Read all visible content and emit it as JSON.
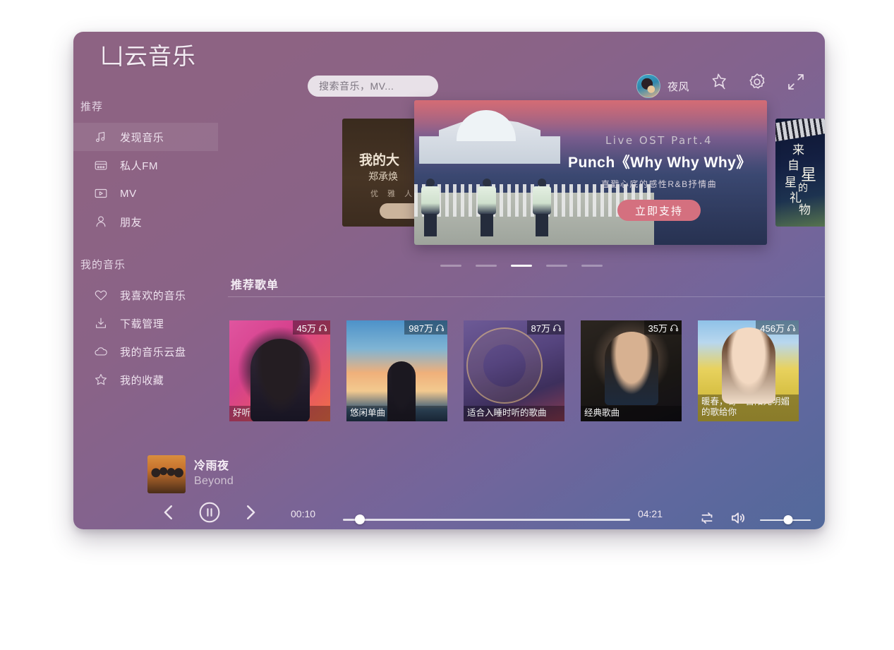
{
  "app": {
    "logo": "凵云音乐",
    "search_placeholder": "搜索音乐，MV...",
    "username": "夜风"
  },
  "header_icons": [
    {
      "name": "magic-star-icon",
      "label": "皮肤"
    },
    {
      "name": "gear-icon",
      "label": "设置"
    },
    {
      "name": "expand-icon",
      "label": "全屏"
    }
  ],
  "sidebar": {
    "section1_title": "推荐",
    "section1_items": [
      {
        "label": "发现音乐",
        "icon": "music-note-icon",
        "active": true
      },
      {
        "label": "私人FM",
        "icon": "radio-icon",
        "active": false
      },
      {
        "label": "MV",
        "icon": "video-icon",
        "active": false
      },
      {
        "label": "朋友",
        "icon": "person-icon",
        "active": false
      }
    ],
    "section2_title": "我的音乐",
    "section2_items": [
      {
        "label": "我喜欢的音乐",
        "icon": "heart-icon"
      },
      {
        "label": "下载管理",
        "icon": "download-icon"
      },
      {
        "label": "我的音乐云盘",
        "icon": "cloud-icon"
      },
      {
        "label": "我的收藏",
        "icon": "star-icon"
      }
    ]
  },
  "carousel": {
    "left_slide": {
      "title": "我的大",
      "subtitle": "郑承焕",
      "caption": "优 雅 人",
      "button": ""
    },
    "center_slide": {
      "eyebrow": "Live OST Part.4",
      "title": "Punch《Why Why Why》",
      "subtitle": "直戳心底的感性R&B抒情曲",
      "cta": "立即支持"
    },
    "right_slide": {
      "lines": [
        "来",
        "自",
        "星",
        "星",
        "的",
        "礼",
        "物"
      ]
    },
    "dots_count": 5,
    "active_dot": 2
  },
  "section": {
    "title": "推荐歌单"
  },
  "playlists": [
    {
      "title": "好听的英文歌",
      "plays": "45万",
      "art": "art1"
    },
    {
      "title": "悠闲单曲",
      "plays": "987万",
      "art": "art2"
    },
    {
      "title": "适合入睡时听的歌曲",
      "plays": "87万",
      "art": "art3"
    },
    {
      "title": "经典歌曲",
      "plays": "35万",
      "art": "art4"
    },
    {
      "title": "暖春，寄一首阳光明媚的歌给你",
      "plays": "456万",
      "art": "art5"
    }
  ],
  "player": {
    "song_title": "冷雨夜",
    "artist": "Beyond",
    "current_time": "00:10",
    "total_time": "04:21",
    "progress_percent": 6,
    "volume_percent": 56,
    "prev_label": "上一首",
    "play_pause_label": "暂停",
    "next_label": "下一首",
    "repeat_label": "循环播放",
    "volume_label": "音量"
  },
  "colors": {
    "window_top_left": "#8d6383",
    "window_bottom_right": "#52699b",
    "cta": "#d4707f",
    "text_light": "#f2eaf2"
  }
}
